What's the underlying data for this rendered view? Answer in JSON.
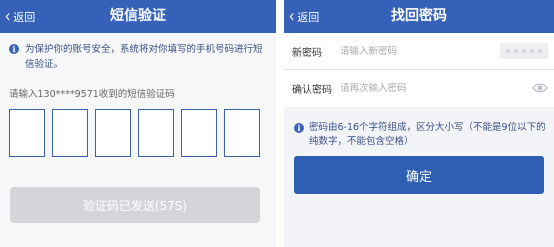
{
  "sms_screen": {
    "back_label": "返回",
    "title": "短信验证",
    "notice": "为保护你的账号安全，系统将对你填写的手机号码进行短信验证。",
    "code_prompt": "请输入130****9571收到的短信验证码",
    "code_digits": [
      "",
      "",
      "",
      "",
      "",
      ""
    ],
    "send_button_label": "验证码已发送(57S)"
  },
  "reset_screen": {
    "back_label": "返回",
    "title": "找回密码",
    "new_password": {
      "label": "新密码",
      "placeholder": "请输入新密码",
      "value": ""
    },
    "confirm_password": {
      "label": "确认密码",
      "placeholder": "请再次输入密码",
      "value": ""
    },
    "notice": "密码由6-16个字符组成，区分大小写（不能是9位以下的纯数字，不能包含空格）",
    "confirm_button_label": "确定"
  },
  "colors": {
    "nav_bar": "#3562b8",
    "primary_button": "#2e5fb3",
    "disabled_button": "#d3d5d9",
    "notice_text": "#3a4f86",
    "code_box_border": "#3d5fa8"
  },
  "icons": {
    "back": "chevron-left-icon",
    "info": "info-icon",
    "keyboard": "keyboard-icon",
    "eye": "eye-icon"
  }
}
